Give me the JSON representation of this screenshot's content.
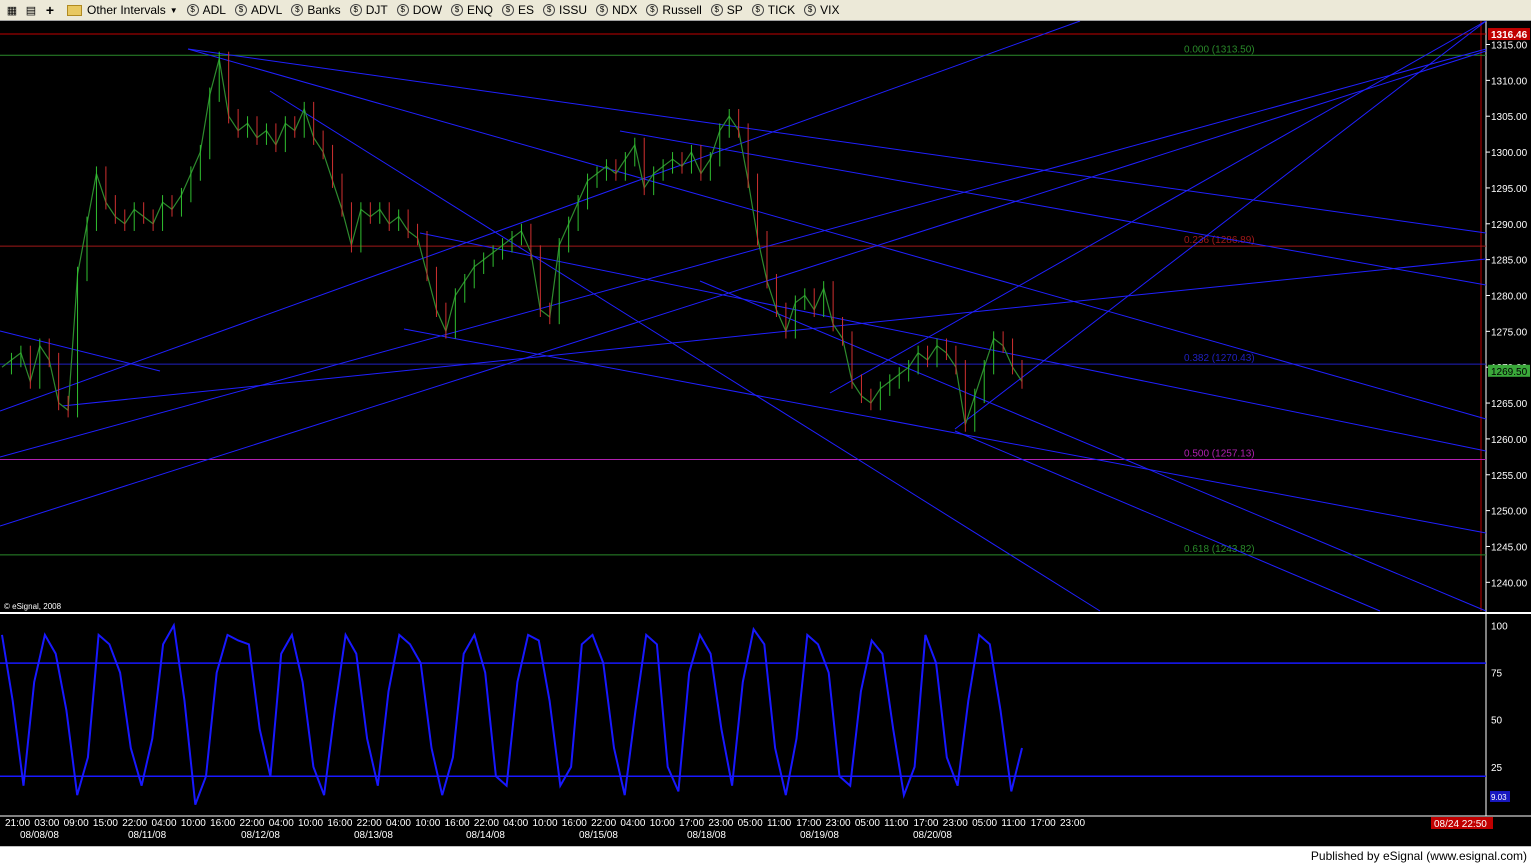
{
  "toolbar": {
    "intervals_label": "Other Intervals",
    "symbols": [
      "ADL",
      "ADVL",
      "Banks",
      "DJT",
      "DOW",
      "ENQ",
      "ES",
      "ISSU",
      "NDX",
      "Russell",
      "SP",
      "TICK",
      "VIX"
    ]
  },
  "footer": {
    "published": "Published by eSignal (www.esignal.com)"
  },
  "colors": {
    "background": "#000000",
    "trendline": "#2020ff",
    "fib_green": "#2a8a2a",
    "fib_red": "#a01818",
    "fib_purple": "#b020b0",
    "price_tag": "#c00000",
    "stoch": "#1818ff"
  },
  "chart_data": [
    {
      "type": "line",
      "title": "",
      "watermark": "© eSignal, 2008",
      "current_price": "1316.46",
      "last_price": "1269.50",
      "ylim": [
        1236,
        1318
      ],
      "yticks": [
        "1315.00",
        "1310.00",
        "1305.00",
        "1300.00",
        "1295.00",
        "1290.00",
        "1285.00",
        "1280.00",
        "1275.00",
        "1270.00",
        "1265.00",
        "1260.00",
        "1255.00",
        "1250.00",
        "1245.00",
        "1240.00"
      ],
      "xticks": [
        "21:00",
        "03:00",
        "09:00",
        "15:00",
        "22:00",
        "04:00",
        "10:00",
        "16:00",
        "22:00",
        "04:00",
        "10:00",
        "16:00",
        "22:00",
        "04:00",
        "10:00",
        "16:00",
        "22:00",
        "04:00",
        "10:00",
        "16:00",
        "22:00",
        "04:00",
        "10:00",
        "17:00",
        "23:00",
        "05:00",
        "11:00",
        "17:00",
        "23:00",
        "05:00",
        "11:00",
        "17:00",
        "23:00",
        "05:00",
        "11:00",
        "17:00",
        "23:00"
      ],
      "date_labels": [
        "08/08/08",
        "08/11/08",
        "08/12/08",
        "08/13/08",
        "08/14/08",
        "08/15/08",
        "08/18/08",
        "08/19/08",
        "08/20/08"
      ],
      "date_box": "08/24 22:50",
      "fib_levels": [
        {
          "label": "0.000 (1313.50)",
          "value": 1313.5,
          "color": "green"
        },
        {
          "label": "0.236 (1286.89)",
          "value": 1286.89,
          "color": "red"
        },
        {
          "label": "0.382 (1270.43)",
          "value": 1270.43,
          "color": "blue"
        },
        {
          "label": "0.500 (1257.13)",
          "value": 1257.13,
          "color": "purple"
        },
        {
          "label": "0.618 (1243.82)",
          "value": 1243.82,
          "color": "green"
        }
      ],
      "price_series": [
        1270,
        1271,
        1272,
        1268,
        1273,
        1271,
        1265,
        1264,
        1283,
        1290,
        1297,
        1293,
        1291,
        1290,
        1292,
        1291,
        1290,
        1293,
        1292,
        1294,
        1297,
        1300,
        1308,
        1313,
        1305,
        1303,
        1304,
        1302,
        1303,
        1301,
        1304,
        1303,
        1306,
        1302,
        1300,
        1296,
        1292,
        1287,
        1292,
        1291,
        1292,
        1290,
        1291,
        1289,
        1288,
        1283,
        1278,
        1275,
        1280,
        1282,
        1284,
        1285,
        1286,
        1287,
        1288,
        1289,
        1286,
        1278,
        1277,
        1287,
        1290,
        1293,
        1296,
        1297,
        1298,
        1297,
        1299,
        1301,
        1295,
        1297,
        1298,
        1299,
        1298,
        1300,
        1297,
        1299,
        1303,
        1305,
        1303,
        1296,
        1288,
        1282,
        1278,
        1275,
        1279,
        1280,
        1278,
        1281,
        1276,
        1274,
        1268,
        1266,
        1265,
        1267,
        1268,
        1269,
        1270,
        1272,
        1271,
        1273,
        1272,
        1270,
        1262,
        1266,
        1270,
        1274,
        1273,
        1270,
        1268
      ]
    },
    {
      "type": "line",
      "title": "",
      "ylim": [
        0,
        105
      ],
      "yticks": [
        "100",
        "75",
        "50",
        "25"
      ],
      "levels": [
        80,
        20
      ],
      "last_value": "9.03",
      "series_values": [
        95,
        60,
        15,
        70,
        95,
        85,
        55,
        10,
        30,
        95,
        90,
        75,
        35,
        15,
        40,
        90,
        100,
        60,
        5,
        20,
        75,
        95,
        92,
        90,
        45,
        20,
        85,
        95,
        70,
        25,
        10,
        55,
        95,
        85,
        40,
        15,
        65,
        95,
        90,
        80,
        35,
        10,
        30,
        85,
        95,
        75,
        20,
        15,
        70,
        95,
        92,
        60,
        15,
        25,
        90,
        95,
        80,
        35,
        10,
        55,
        95,
        90,
        25,
        12,
        75,
        95,
        85,
        45,
        15,
        70,
        98,
        90,
        35,
        10,
        40,
        95,
        90,
        75,
        20,
        15,
        65,
        92,
        85,
        45,
        10,
        25,
        95,
        80,
        30,
        15,
        60,
        95,
        90,
        55,
        12,
        35
      ]
    }
  ]
}
